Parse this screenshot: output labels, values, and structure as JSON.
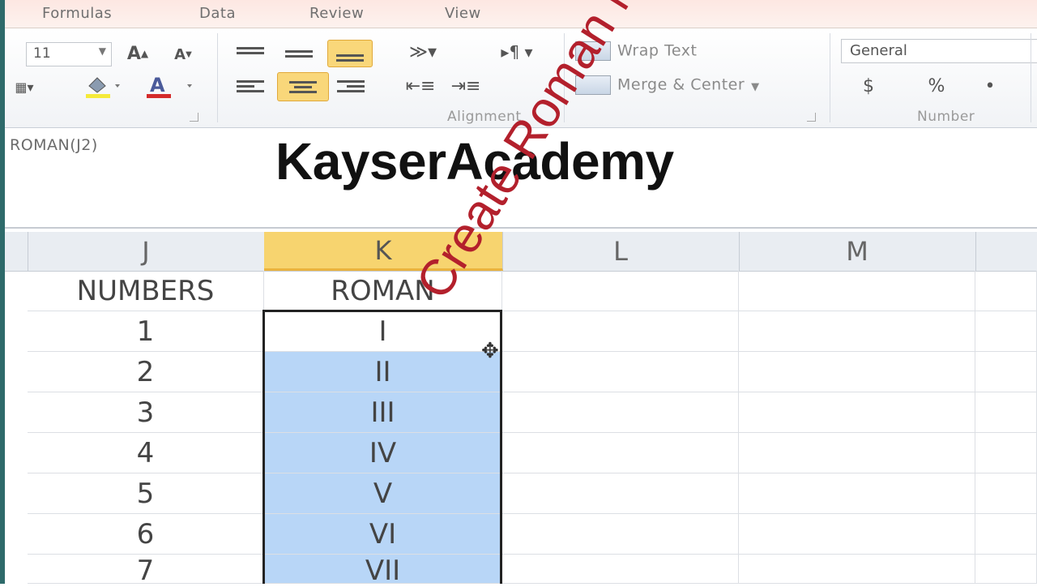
{
  "ribbon": {
    "tabs": [
      "Formulas",
      "Data",
      "Review",
      "View"
    ],
    "font_size": "11",
    "alignment_label": "Alignment",
    "number_label": "Number",
    "wrap_text": "Wrap Text",
    "merge_center": "Merge & Center",
    "number_format": "General",
    "percent": "%",
    "comma": "•",
    "dollar": "$"
  },
  "formula_bar": {
    "formula": "ROMAN(J2)"
  },
  "watermark": "KayserAcademy",
  "overlay_caption": "Create Roman Number",
  "columns": [
    "J",
    "K",
    "L",
    "M"
  ],
  "headers": {
    "numbers": "NUMBERS",
    "roman": "ROMAN"
  },
  "rows": [
    {
      "n": "1",
      "r": "I"
    },
    {
      "n": "2",
      "r": "II"
    },
    {
      "n": "3",
      "r": "III"
    },
    {
      "n": "4",
      "r": "IV"
    },
    {
      "n": "5",
      "r": "V"
    },
    {
      "n": "6",
      "r": "VI"
    },
    {
      "n": "7",
      "r": "VII"
    }
  ]
}
